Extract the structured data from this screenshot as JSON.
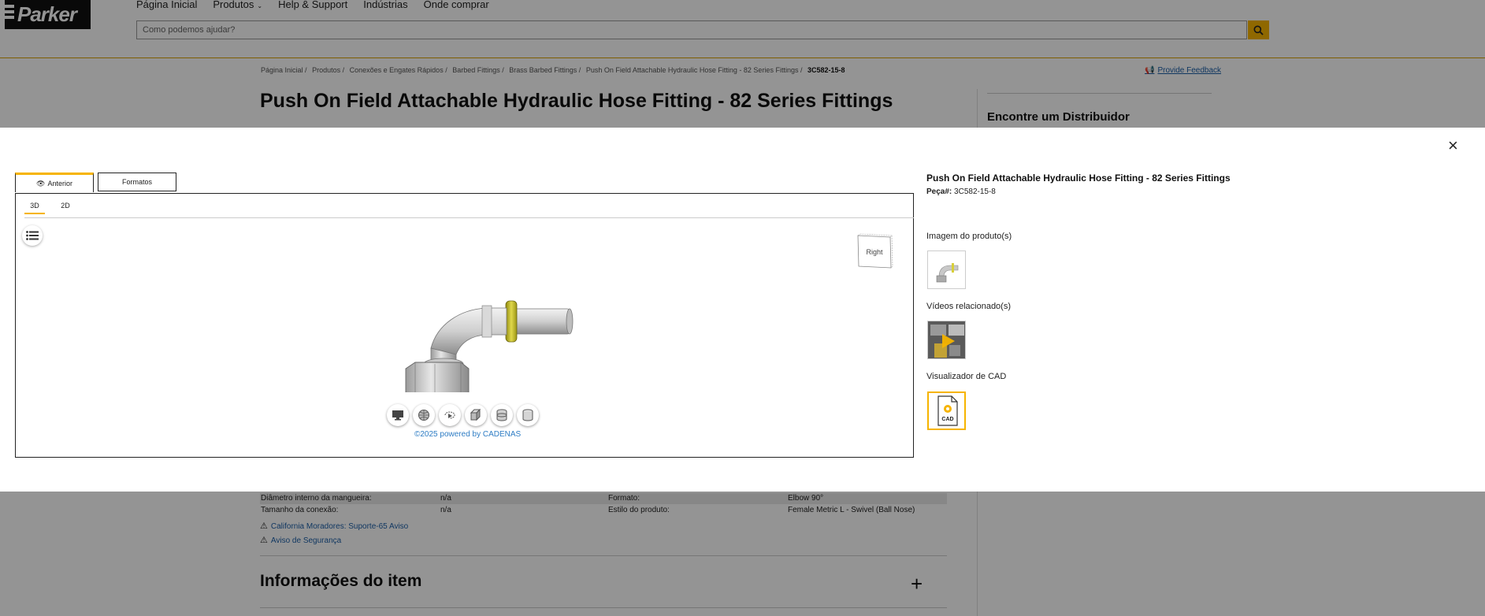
{
  "header": {
    "logo_text": "Parker",
    "nav": [
      "Página Inicial",
      "Produtos",
      "Help & Support",
      "Indústrias",
      "Onde comprar"
    ],
    "search_placeholder": "Como podemos ajudar?"
  },
  "breadcrumb": {
    "items": [
      "Página Inicial /",
      "Produtos /",
      "Conexões e Engates Rápidos /",
      "Barbed Fittings /",
      "Brass Barbed Fittings /",
      "Push On Field Attachable Hydraulic Hose Fitting - 82 Series Fittings /"
    ],
    "current": "3C582-15-8"
  },
  "feedback_link": "Provide Feedback",
  "page_title": "Push On Field Attachable Hydraulic Hose Fitting - 82 Series Fittings",
  "sidebar": {
    "distributor_heading": "Encontre um Distribuidor"
  },
  "specs": {
    "rows": [
      {
        "label1": "Diâmetro interno da mangueira:",
        "value1": "n/a",
        "label2": "Formato:",
        "value2": "Elbow 90°"
      },
      {
        "label1": "Tamanho da conexão:",
        "value1": "n/a",
        "label2": "Estilo do produto:",
        "value2": "Female Metric L - Swivel (Ball Nose)"
      }
    ],
    "warnings": [
      "California Moradores: Suporte-65 Aviso",
      "Aviso de Segurança"
    ]
  },
  "item_info_heading": "Informações do item",
  "modal": {
    "close_label": "×",
    "tabs": [
      "Anterior",
      "Formatos"
    ],
    "view_tabs": [
      "3D",
      "2D"
    ],
    "cube_label": "Right",
    "powered_by": "©2025 powered by CADENAS",
    "product_title": "Push On Field Attachable Hydraulic Hose Fitting - 82 Series Fittings",
    "part_label": "Peça#:",
    "part_number": "3C582-15-8",
    "images_label": "Imagem do produto(s)",
    "videos_label": "Vídeos relacionado(s)",
    "cad_label": "Visualizador de CAD",
    "cad_thumb_text": "CAD"
  },
  "colors": {
    "accent": "#f6b400",
    "link": "#1c5fa8",
    "brass": "#c9c020"
  }
}
